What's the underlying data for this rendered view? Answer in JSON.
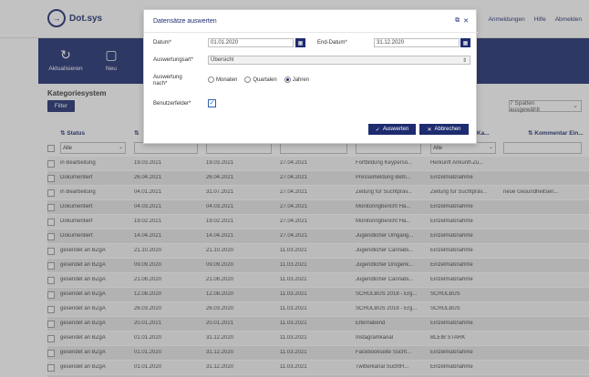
{
  "app": {
    "logo_text": "Dot.sys",
    "header_links": [
      "Anmeldungen",
      "Hilfe",
      "Abmelden"
    ]
  },
  "toolbar": {
    "refresh_label": "Aktualisieren",
    "new_label": "Neu"
  },
  "section": {
    "title": "Kategoriesystem",
    "filter_button": "Filter",
    "columns_selected": "7 Spalten ausgewählt"
  },
  "table": {
    "headers": [
      "Status",
      "",
      "",
      "",
      "",
      "/ Ka...",
      "Kommentar Ein..."
    ],
    "filter_values": [
      "Alle",
      "",
      "",
      "",
      "",
      "Alle",
      ""
    ],
    "rows": [
      [
        "in Bearbeitung",
        "19.03.2021",
        "19.03.2021",
        "27.04.2021",
        "Fortbildung Keyperso...",
        "Herkunft Ankunft-Zu...",
        ""
      ],
      [
        "Dokumentiert",
        "26.04.2021",
        "26.04.2021",
        "27.04.2021",
        "Pressemeldung Betri...",
        "Einzelmaßnahme",
        ""
      ],
      [
        "in Bearbeitung",
        "04.01.2021",
        "31.07.2021",
        "27.04.2021",
        "Zeitung für Suchtpräv...",
        "Zeitung für Suchtpräv...",
        "neue Gesundheitsen..."
      ],
      [
        "Dokumentiert",
        "04.03.2021",
        "04.03.2021",
        "27.04.2021",
        "Monitoringbericht Ha...",
        "Einzelmaßnahme",
        ""
      ],
      [
        "Dokumentiert",
        "19.02.2021",
        "19.02.2021",
        "27.04.2021",
        "Monitoringbericht Ha...",
        "Einzelmaßnahme",
        ""
      ],
      [
        "Dokumentiert",
        "14.04.2021",
        "14.04.2021",
        "27.04.2021",
        "Jugendlicher Umgang...",
        "Einzelmaßnahme",
        ""
      ],
      [
        "gesendet an BZgA",
        "21.10.2020",
        "21.10.2020",
        "11.03.2021",
        "Jugendlicher Cannabi...",
        "Einzelmaßnahme",
        ""
      ],
      [
        "gesendet an BZgA",
        "09.09.2020",
        "09.09.2020",
        "11.03.2021",
        "Jugendlicher Drogenk...",
        "Einzelmaßnahme",
        ""
      ],
      [
        "gesendet an BZgA",
        "21.08.2020",
        "21.08.2020",
        "11.03.2021",
        "Jugendlicher Cannabi...",
        "Einzelmaßnahme",
        ""
      ],
      [
        "gesendet an BZgA",
        "12.08.2020",
        "12.08.2020",
        "11.03.2021",
        "SCHULBUS 2018 - Erg...",
        "SCHULBUS",
        ""
      ],
      [
        "gesendet an BZgA",
        "26.03.2020",
        "26.03.2020",
        "11.03.2021",
        "SCHULBUS 2018 - Erg...",
        "SCHULBUS",
        ""
      ],
      [
        "gesendet an BZgA",
        "20.01.2021",
        "20.01.2021",
        "11.03.2021",
        "Elternabend",
        "Einzelmaßnahme",
        ""
      ],
      [
        "gesendet an BZgA",
        "01.01.2020",
        "31.12.2020",
        "11.03.2021",
        "Instagramkanal",
        "BLEIB STARK",
        ""
      ],
      [
        "gesendet an BZgA",
        "01.01.2020",
        "31.12.2020",
        "11.03.2021",
        "Facebookseite Sucht...",
        "Einzelmaßnahme",
        ""
      ],
      [
        "gesendet an BZgA",
        "01.01.2020",
        "31.12.2020",
        "11.03.2021",
        "Twitterkanal SuchtH...",
        "Einzelmaßnahme",
        ""
      ],
      [
        "gesendet an BZgA",
        "16.10.2020",
        "16.10.2020",
        "11.03.2021",
        "Treffen bezirkliche Su...",
        "Einzelmaßnahme",
        ""
      ]
    ]
  },
  "modal": {
    "title": "Datensätze auswerten",
    "datum_label": "Datum*",
    "datum_value": "01.01.2020",
    "end_datum_label": "End-Datum*",
    "end_datum_value": "31.12.2020",
    "auswertungsart_label": "Auswertungsart*",
    "auswertungsart_value": "Übersicht",
    "auswertung_nach_label": "Auswertung nach*",
    "radio_monaten": "Monaten",
    "radio_quartalen": "Quartalen",
    "radio_jahren": "Jahren",
    "benutzerfelder_label": "Benutzerfelder*",
    "auswerten_button": "Auswerten",
    "abbrechen_button": "Abbrechen"
  },
  "colors": {
    "primary": "#1d2b6f",
    "row_alt": "#e6e6e6",
    "row_plain": "#f5f5f5"
  }
}
